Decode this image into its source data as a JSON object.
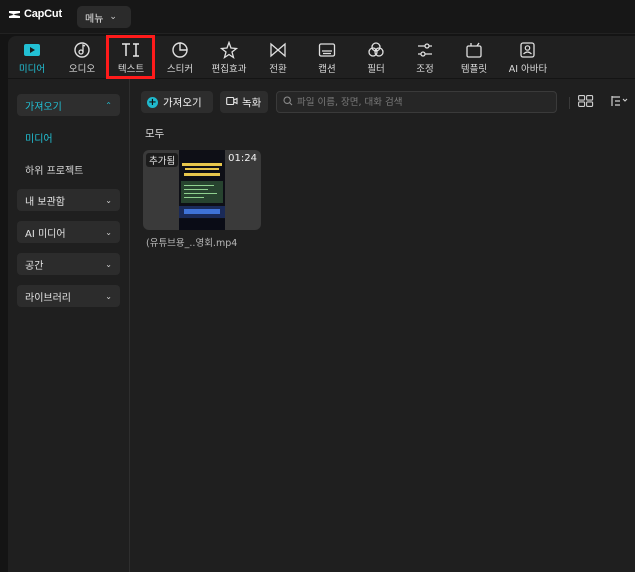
{
  "app": {
    "name": "CapCut"
  },
  "titlebar": {
    "menu_label": "메뉴"
  },
  "toolbar": {
    "items": [
      {
        "label": "미디어",
        "icon": "media-play-icon",
        "active": true
      },
      {
        "label": "오디오",
        "icon": "audio-note-icon"
      },
      {
        "label": "텍스트",
        "icon": "text-TI-icon",
        "highlighted": true
      },
      {
        "label": "스티커",
        "icon": "sticker-icon"
      },
      {
        "label": "편집효과",
        "icon": "effects-star-icon"
      },
      {
        "label": "전환",
        "icon": "transition-bowtie-icon"
      },
      {
        "label": "캡션",
        "icon": "captions-icon"
      },
      {
        "label": "필터",
        "icon": "filter-circles-icon"
      },
      {
        "label": "조정",
        "icon": "adjust-sliders-icon"
      },
      {
        "label": "템플릿",
        "icon": "template-icon"
      },
      {
        "label": "AI 아바타",
        "icon": "ai-avatar-icon"
      }
    ]
  },
  "sidebar": {
    "import_label": "가져오기",
    "media_label": "미디어",
    "sub_project_label": "하위 프로젝트",
    "my_storage_label": "내 보관함",
    "ai_media_label": "AI 미디어",
    "space_label": "공간",
    "library_label": "라이브러리"
  },
  "content": {
    "import_button": "가져오기",
    "record_button": "녹화",
    "search_placeholder": "파일 이름, 장면, 대화 검색",
    "section_all": "모두",
    "media_items": [
      {
        "badge": "추가됨",
        "duration": "01:24",
        "filename": "(유튜브용_..영회.mp4"
      }
    ]
  },
  "colors": {
    "accent": "#22c0d4",
    "highlight_box": "#ff1b1b"
  }
}
